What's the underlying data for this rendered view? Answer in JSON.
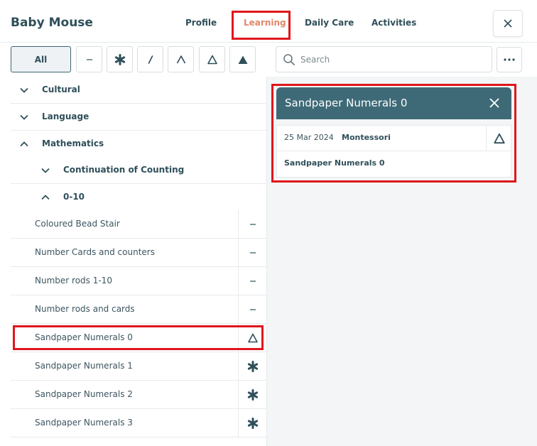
{
  "header": {
    "title": "Baby Mouse",
    "tabs": [
      {
        "label": "Profile"
      },
      {
        "label": "Learning"
      },
      {
        "label": "Daily Care"
      },
      {
        "label": "Activities"
      }
    ]
  },
  "filters": {
    "all_label": "All",
    "options": [
      "dash-icon",
      "asterisk-icon",
      "slash-icon",
      "caret-icon",
      "triangle-outline-icon",
      "triangle-filled-icon"
    ]
  },
  "search": {
    "placeholder": "Search"
  },
  "tree": {
    "categories": [
      {
        "label": "Cultural",
        "expanded": false
      },
      {
        "label": "Language",
        "expanded": false
      },
      {
        "label": "Mathematics",
        "expanded": true
      },
      {
        "label": "Continuation of Counting",
        "expanded": false
      },
      {
        "label": "0-10",
        "expanded": true
      }
    ],
    "items": [
      {
        "label": "Coloured Bead Stair",
        "mark": "dash"
      },
      {
        "label": "Number Cards and counters",
        "mark": "dash"
      },
      {
        "label": "Number rods 1-10",
        "mark": "dash"
      },
      {
        "label": "Number rods and cards",
        "mark": "dash"
      },
      {
        "label": "Sandpaper Numerals 0",
        "mark": "triangle"
      },
      {
        "label": "Sandpaper Numerals 1",
        "mark": "asterisk"
      },
      {
        "label": "Sandpaper Numerals 2",
        "mark": "asterisk"
      },
      {
        "label": "Sandpaper Numerals 3",
        "mark": "asterisk"
      }
    ]
  },
  "detail": {
    "title": "Sandpaper Numerals 0",
    "date": "25 Mar 2024",
    "source": "Montessori",
    "name": "Sandpaper Numerals 0"
  },
  "colors": {
    "accent": "#e0876b",
    "header_bg": "#3e6a77",
    "text": "#2f4f5a",
    "highlight": "#e0161b"
  }
}
